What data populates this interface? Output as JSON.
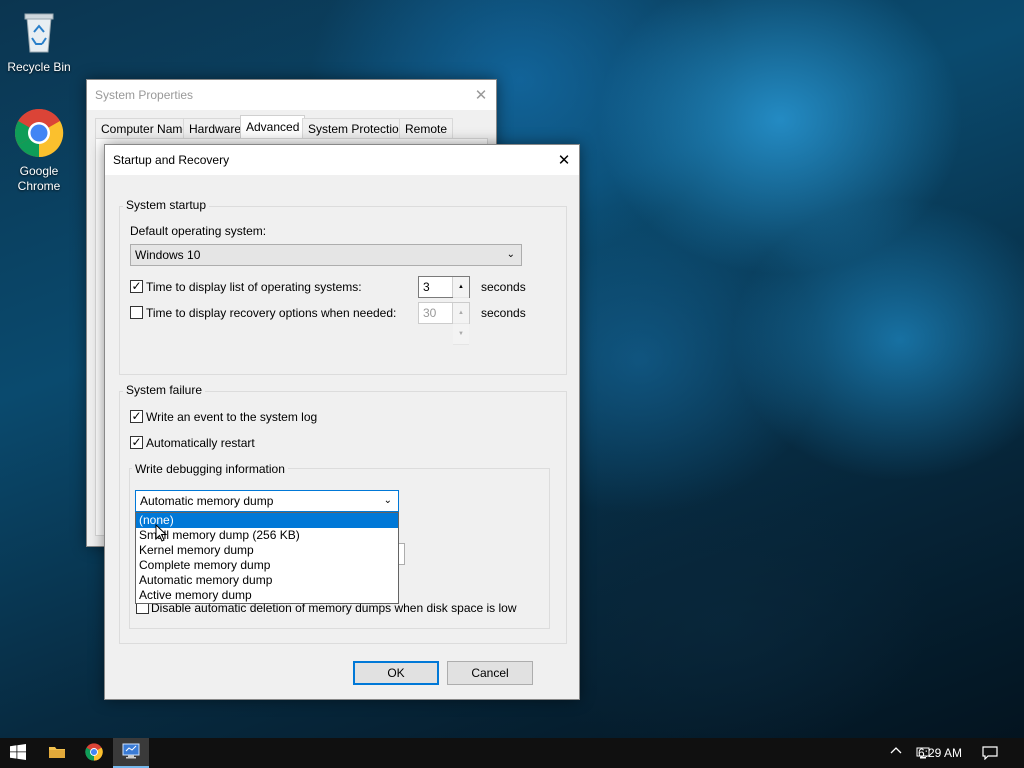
{
  "desktop": {
    "icons": [
      {
        "label": "Recycle Bin"
      },
      {
        "label": "Google Chrome"
      }
    ]
  },
  "system_properties": {
    "title": "System Properties",
    "tabs": [
      {
        "label": "Computer Name"
      },
      {
        "label": "Hardware"
      },
      {
        "label": "Advanced",
        "active": true
      },
      {
        "label": "System Protection"
      },
      {
        "label": "Remote"
      }
    ]
  },
  "dialog": {
    "title": "Startup and Recovery",
    "system_startup": {
      "legend": "System startup",
      "default_os_label": "Default operating system:",
      "default_os_value": "Windows 10",
      "display_list_label": "Time to display list of operating systems:",
      "display_list_checked": true,
      "display_list_value": "3",
      "display_list_unit": "seconds",
      "recovery_label": "Time to display recovery options when needed:",
      "recovery_checked": false,
      "recovery_value": "30",
      "recovery_unit": "seconds"
    },
    "system_failure": {
      "legend": "System failure",
      "write_event_label": "Write an event to the system log",
      "write_event_checked": true,
      "auto_restart_label": "Automatically restart",
      "auto_restart_checked": true,
      "debug_legend": "Write debugging information",
      "debug_selected": "Automatic memory dump",
      "debug_options": [
        {
          "label": "(none)",
          "highlighted": true
        },
        {
          "label": "Small memory dump (256 KB)"
        },
        {
          "label": "Kernel memory dump"
        },
        {
          "label": "Complete memory dump"
        },
        {
          "label": "Automatic memory dump"
        },
        {
          "label": "Active memory dump"
        }
      ],
      "disable_delete_label": "Disable automatic deletion of memory dumps when disk space is low",
      "disable_delete_checked": false
    },
    "ok_label": "OK",
    "cancel_label": "Cancel"
  },
  "taskbar": {
    "clock": "6:29 AM"
  },
  "colors": {
    "accent": "#0078d7",
    "taskbar": "#101010"
  }
}
